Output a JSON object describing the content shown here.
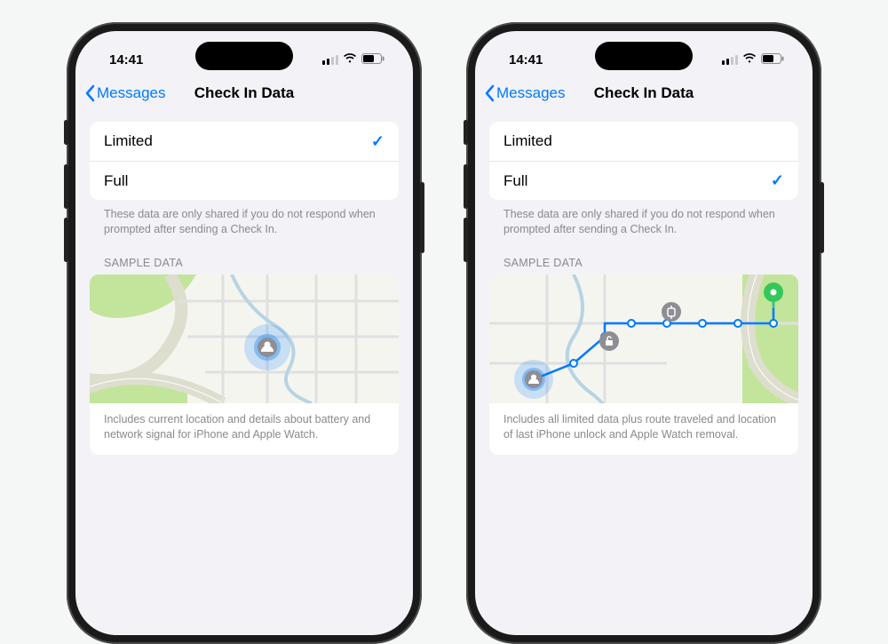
{
  "status": {
    "time": "14:41"
  },
  "nav": {
    "back_label": "Messages",
    "title": "Check In Data"
  },
  "options": {
    "limited": "Limited",
    "full": "Full",
    "footer": "These data are only shared if you do not respond when prompted after sending a Check In."
  },
  "sample": {
    "header": "SAMPLE DATA",
    "limited_desc": "Includes current location and details about battery and network signal for iPhone and Apple Watch.",
    "full_desc": "Includes all limited data plus route traveled and location of last iPhone unlock and Apple Watch removal."
  },
  "phones": {
    "left": {
      "selected": "limited"
    },
    "right": {
      "selected": "full"
    }
  },
  "colors": {
    "tint": "#007aff",
    "park": "#c3e59b",
    "road_major": "#dedecf",
    "road_minor": "#e8e8e8",
    "water": "#b8d4e3"
  }
}
